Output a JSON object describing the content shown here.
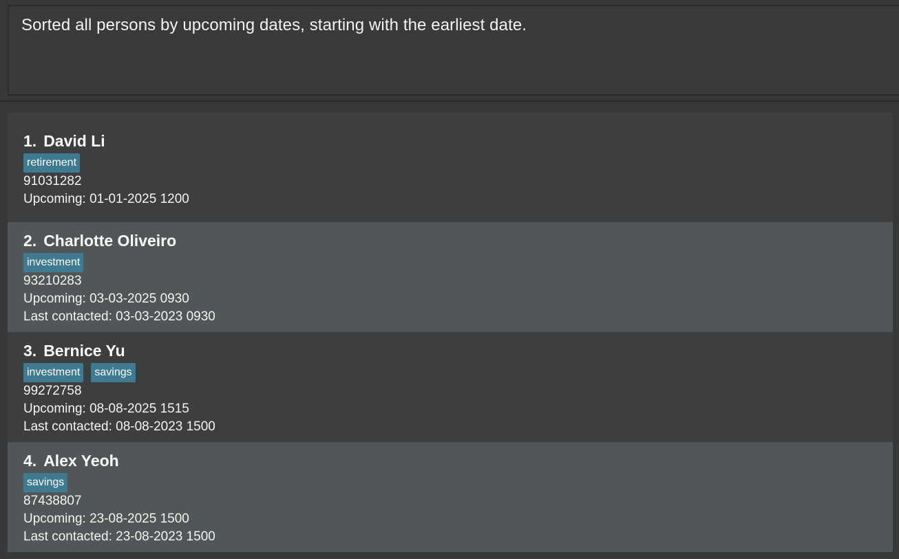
{
  "result_display": {
    "message": "Sorted all persons by upcoming dates, starting with the earliest date."
  },
  "persons": [
    {
      "index": "1.",
      "name": "David Li",
      "tags": [
        "retirement"
      ],
      "phone": "91031282",
      "upcoming": "Upcoming: 01-01-2025 1200",
      "last_contacted": ""
    },
    {
      "index": "2.",
      "name": "Charlotte Oliveiro",
      "tags": [
        "investment"
      ],
      "phone": "93210283",
      "upcoming": "Upcoming: 03-03-2025 0930",
      "last_contacted": "Last contacted: 03-03-2023 0930"
    },
    {
      "index": "3.",
      "name": "Bernice Yu",
      "tags": [
        "investment",
        "savings"
      ],
      "phone": "99272758",
      "upcoming": "Upcoming: 08-08-2025 1515",
      "last_contacted": "Last contacted: 08-08-2023 1500"
    },
    {
      "index": "4.",
      "name": "Alex Yeoh",
      "tags": [
        "savings"
      ],
      "phone": "87438807",
      "upcoming": "Upcoming: 23-08-2025 1500",
      "last_contacted": "Last contacted: 23-08-2023 1500"
    }
  ],
  "colors": {
    "background": "#383838",
    "card_dark": "#3c3e3f",
    "card_light": "#515658",
    "tag": "#3e7b91",
    "text": "#ffffff"
  }
}
